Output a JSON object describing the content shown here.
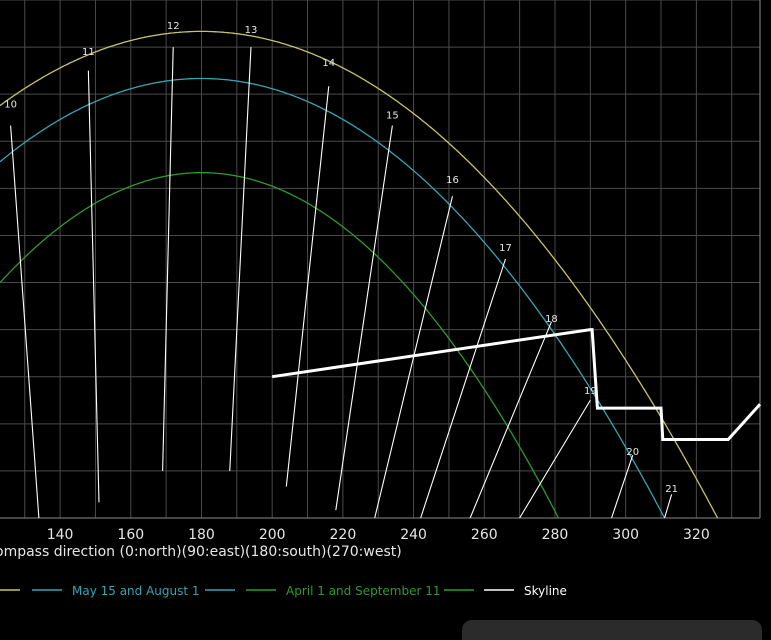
{
  "chart_data": {
    "type": "line",
    "xlabel": "ompass direction (0:north)(90:east)(180:south)(270:west)",
    "xlim": [
      123,
      338
    ],
    "ylim": [
      0,
      66
    ],
    "x_ticks": [
      140,
      160,
      180,
      200,
      220,
      240,
      260,
      280,
      300,
      320
    ],
    "grid": true,
    "colors": {
      "background": "#000000",
      "grid": "#4a4a4a",
      "summer": "#c8c36a",
      "may_aug": "#3aa3b3",
      "apr_sep": "#2f9a2f",
      "skyline": "#ffffff",
      "hour_lines": "#ffffff"
    },
    "sun_paths": [
      {
        "key": "summer",
        "name": "",
        "peak_x": 180,
        "peak_alt": 62,
        "span_x": 146
      },
      {
        "key": "may_aug",
        "name": "May 15 and August 1",
        "peak_x": 180,
        "peak_alt": 56,
        "span_x": 131
      },
      {
        "key": "apr_sep",
        "name": "April 1 and September 11",
        "peak_x": 180,
        "peak_alt": 44,
        "span_x": 101
      }
    ],
    "hour_lines": [
      {
        "label": "10",
        "label_x": 126,
        "label_alt": 52.3,
        "top": [
          126,
          50
        ],
        "bottom": [
          134,
          0
        ]
      },
      {
        "label": "11",
        "label_x": 148,
        "label_alt": 59,
        "top": [
          148,
          57
        ],
        "bottom": [
          151,
          2
        ]
      },
      {
        "label": "12",
        "label_x": 172,
        "label_alt": 62.3,
        "top": [
          172,
          60
        ],
        "bottom": [
          169,
          6
        ]
      },
      {
        "label": "13",
        "label_x": 194,
        "label_alt": 61.8,
        "top": [
          194,
          60
        ],
        "bottom": [
          188,
          6
        ]
      },
      {
        "label": "14",
        "label_x": 216,
        "label_alt": 57.6,
        "top": [
          216,
          55
        ],
        "bottom": [
          204,
          4
        ]
      },
      {
        "label": "15",
        "label_x": 234,
        "label_alt": 50.9,
        "top": [
          234,
          50
        ],
        "bottom": [
          218,
          1
        ]
      },
      {
        "label": "16",
        "label_x": 251,
        "label_alt": 42.7,
        "top": [
          251,
          41
        ],
        "bottom": [
          229,
          0
        ]
      },
      {
        "label": "17",
        "label_x": 266,
        "label_alt": 34,
        "top": [
          266,
          33
        ],
        "bottom": [
          242,
          0
        ]
      },
      {
        "label": "18",
        "label_x": 279,
        "label_alt": 25,
        "top": [
          279,
          25
        ],
        "bottom": [
          256,
          0
        ]
      },
      {
        "label": "19",
        "label_x": 290,
        "label_alt": 15.8,
        "top": [
          290,
          15
        ],
        "bottom": [
          270,
          0
        ]
      },
      {
        "label": "20",
        "label_x": 302,
        "label_alt": 8,
        "top": [
          302,
          8
        ],
        "bottom": [
          296,
          0
        ]
      },
      {
        "label": "21",
        "label_x": 313,
        "label_alt": 3.3,
        "top": [
          313,
          3
        ],
        "bottom": [
          311,
          0
        ]
      }
    ],
    "skyline": {
      "name": "Skyline",
      "points": [
        [
          200,
          18
        ],
        [
          290,
          24
        ],
        [
          290.5,
          24
        ],
        [
          292,
          14
        ],
        [
          310,
          14
        ],
        [
          310.5,
          10
        ],
        [
          329,
          10
        ],
        [
          338,
          14.5
        ]
      ]
    },
    "legend": [
      {
        "key": "summer",
        "label": ""
      },
      {
        "key": "may_aug",
        "label": "May 15 and August 1"
      },
      {
        "key": "apr_sep",
        "label": "April 1 and September 11"
      },
      {
        "key": "skyline",
        "label": "Skyline"
      }
    ]
  }
}
